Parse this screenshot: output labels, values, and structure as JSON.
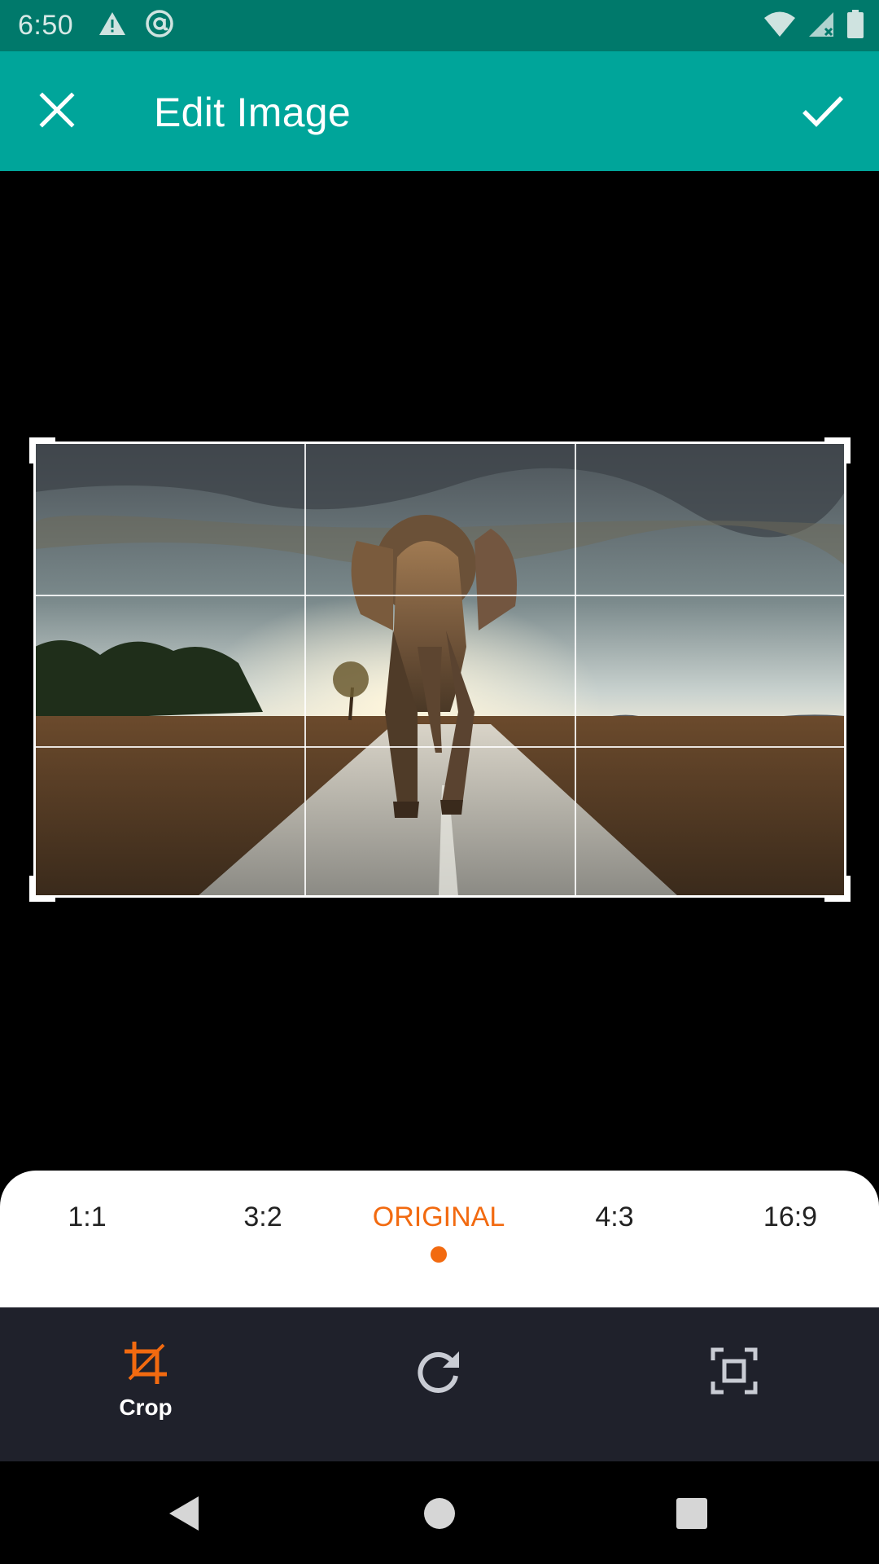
{
  "status_bar": {
    "time": "6:50",
    "icons": [
      "warning-icon",
      "at-sign-icon",
      "wifi-icon",
      "signal-icon",
      "battery-icon"
    ]
  },
  "app_bar": {
    "title": "Edit Image",
    "close_icon": "close-icon",
    "confirm_icon": "check-icon",
    "background_color": "#00a59a"
  },
  "canvas": {
    "image_subject": "elephant-on-road-photo"
  },
  "aspect_ratios": {
    "items": [
      "1:1",
      "3:2",
      "ORIGINAL",
      "4:3",
      "16:9"
    ],
    "selected": "ORIGINAL",
    "accent_color": "#f26a10"
  },
  "tools": {
    "crop_label": "Crop",
    "crop_icon": "crop-icon",
    "rotate_icon": "rotate-icon",
    "fit_icon": "fit-screen-icon"
  },
  "nav": {
    "back_icon": "back-icon",
    "home_icon": "home-icon",
    "recents_icon": "recents-icon"
  }
}
